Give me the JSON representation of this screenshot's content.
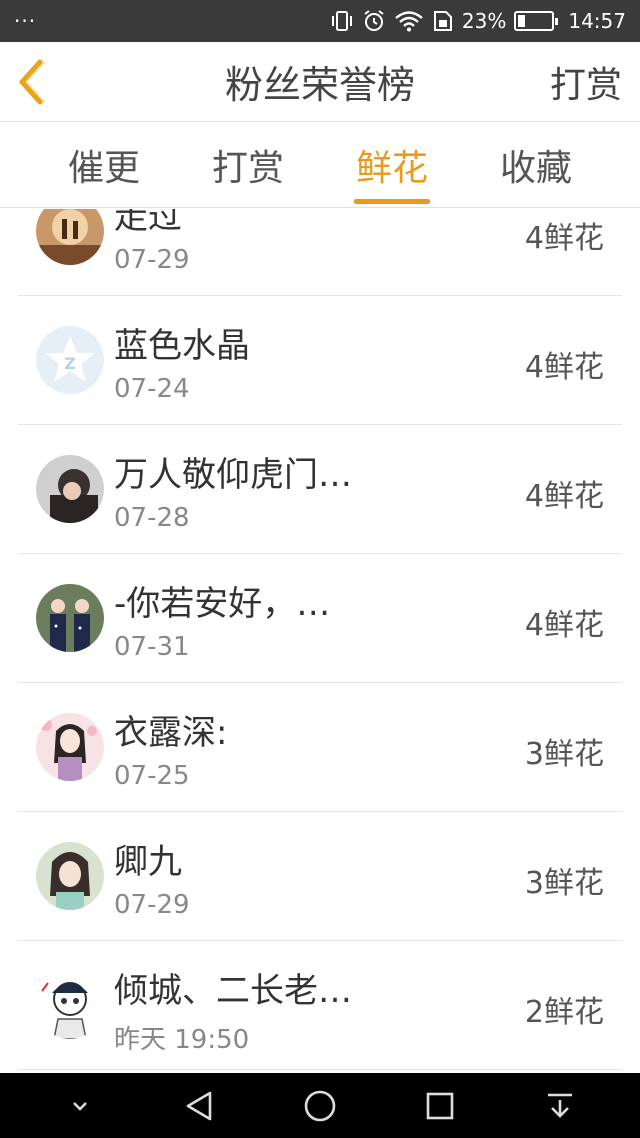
{
  "status_bar": {
    "menu_dots": "···",
    "battery_percent": "23%",
    "time": "14:57",
    "icons": [
      "vibrate-icon",
      "alarm-icon",
      "wifi-icon",
      "sim-icon",
      "battery-icon"
    ],
    "battery_level": 0.23
  },
  "nav": {
    "title": "粉丝荣誉榜",
    "action_label": "打赏",
    "accent_color": "#e89b1c"
  },
  "tabs": [
    {
      "label": "催更",
      "active": false
    },
    {
      "label": "打赏",
      "active": false
    },
    {
      "label": "鲜花",
      "active": true
    },
    {
      "label": "收藏",
      "active": false
    }
  ],
  "fans": [
    {
      "name": "走过",
      "date": "07-29",
      "amount": "4鲜花",
      "avatar": "scenery-avatar"
    },
    {
      "name": "蓝色水晶",
      "date": "07-24",
      "amount": "4鲜花",
      "avatar": "qzone-default-avatar"
    },
    {
      "name": "万人敬仰虎门…",
      "date": "07-28",
      "amount": "4鲜花",
      "avatar": "person-photo-avatar"
    },
    {
      "name": "-你若安好，…",
      "date": "07-31",
      "amount": "4鲜花",
      "avatar": "group-photo-avatar"
    },
    {
      "name": "衣露深:",
      "date": "07-25",
      "amount": "3鲜花",
      "avatar": "anime-girl-avatar"
    },
    {
      "name": "卿九",
      "date": "07-29",
      "amount": "3鲜花",
      "avatar": "anime-girl-2-avatar"
    },
    {
      "name": "倾城、二长老…",
      "date": "昨天 19:50",
      "amount": "2鲜花",
      "avatar": "sketch-avatar"
    }
  ],
  "system_nav": {
    "icons": [
      "chevron-down-icon",
      "back-triangle-icon",
      "home-circle-icon",
      "recents-square-icon",
      "notification-pull-icon"
    ]
  }
}
